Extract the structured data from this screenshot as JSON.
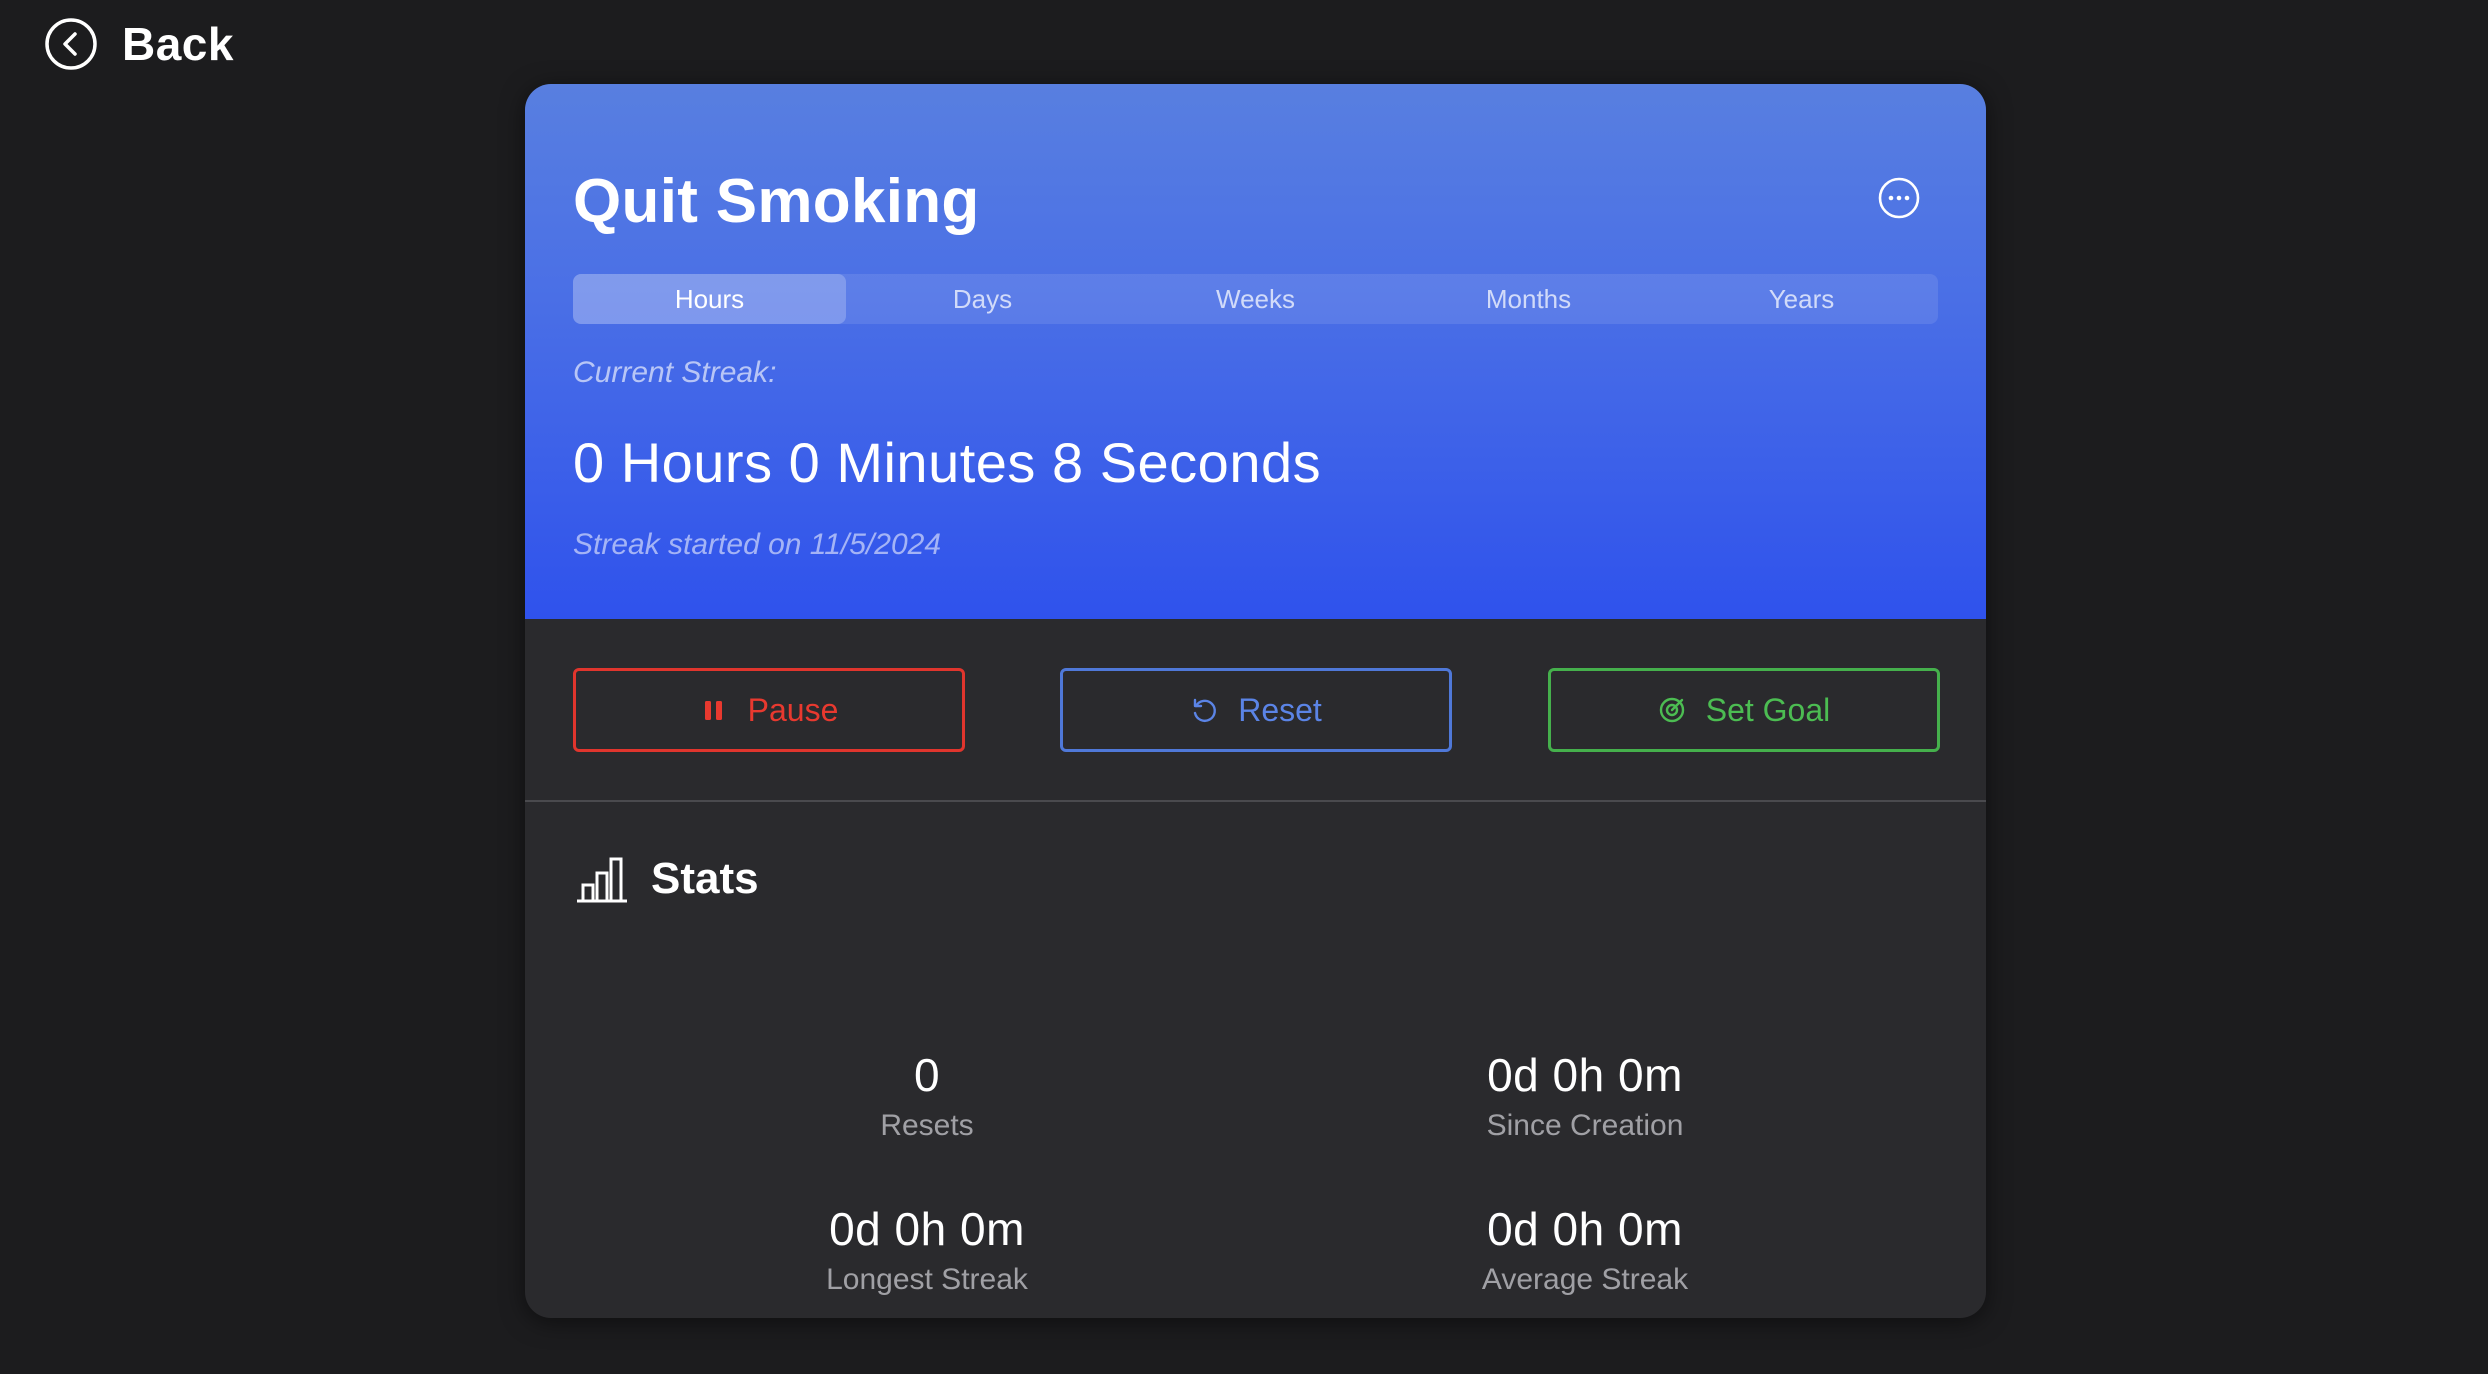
{
  "nav": {
    "back_label": "Back",
    "back_icon": "chevron-left-circle-icon"
  },
  "habit": {
    "title": "Quit Smoking",
    "more_icon": "ellipsis-circle-icon",
    "tabs": [
      {
        "label": "Hours",
        "active": true
      },
      {
        "label": "Days",
        "active": false
      },
      {
        "label": "Weeks",
        "active": false
      },
      {
        "label": "Months",
        "active": false
      },
      {
        "label": "Years",
        "active": false
      }
    ],
    "streak_label": "Current Streak:",
    "streak_value": "0 Hours 0 Minutes 8 Seconds",
    "streak_started": "Streak started on 11/5/2024"
  },
  "actions": {
    "pause": {
      "label": "Pause",
      "icon": "pause-icon",
      "color": "#e8392f"
    },
    "reset": {
      "label": "Reset",
      "icon": "rotate-ccw-icon",
      "color": "#5b84e6"
    },
    "goal": {
      "label": "Set Goal",
      "icon": "target-icon",
      "color": "#4cbd52"
    }
  },
  "stats": {
    "title": "Stats",
    "icon": "bar-chart-icon",
    "items": [
      {
        "value": "0",
        "label": "Resets"
      },
      {
        "value": "0d 0h 0m",
        "label": "Since Creation"
      },
      {
        "value": "0d 0h 0m",
        "label": "Longest Streak"
      },
      {
        "value": "0d 0h 0m",
        "label": "Average Streak"
      }
    ]
  },
  "colors": {
    "background": "#1c1c1e",
    "card": "#2a2a2d",
    "hero_gradient_top": "#587fe0",
    "hero_gradient_bottom": "#2f52ec"
  }
}
